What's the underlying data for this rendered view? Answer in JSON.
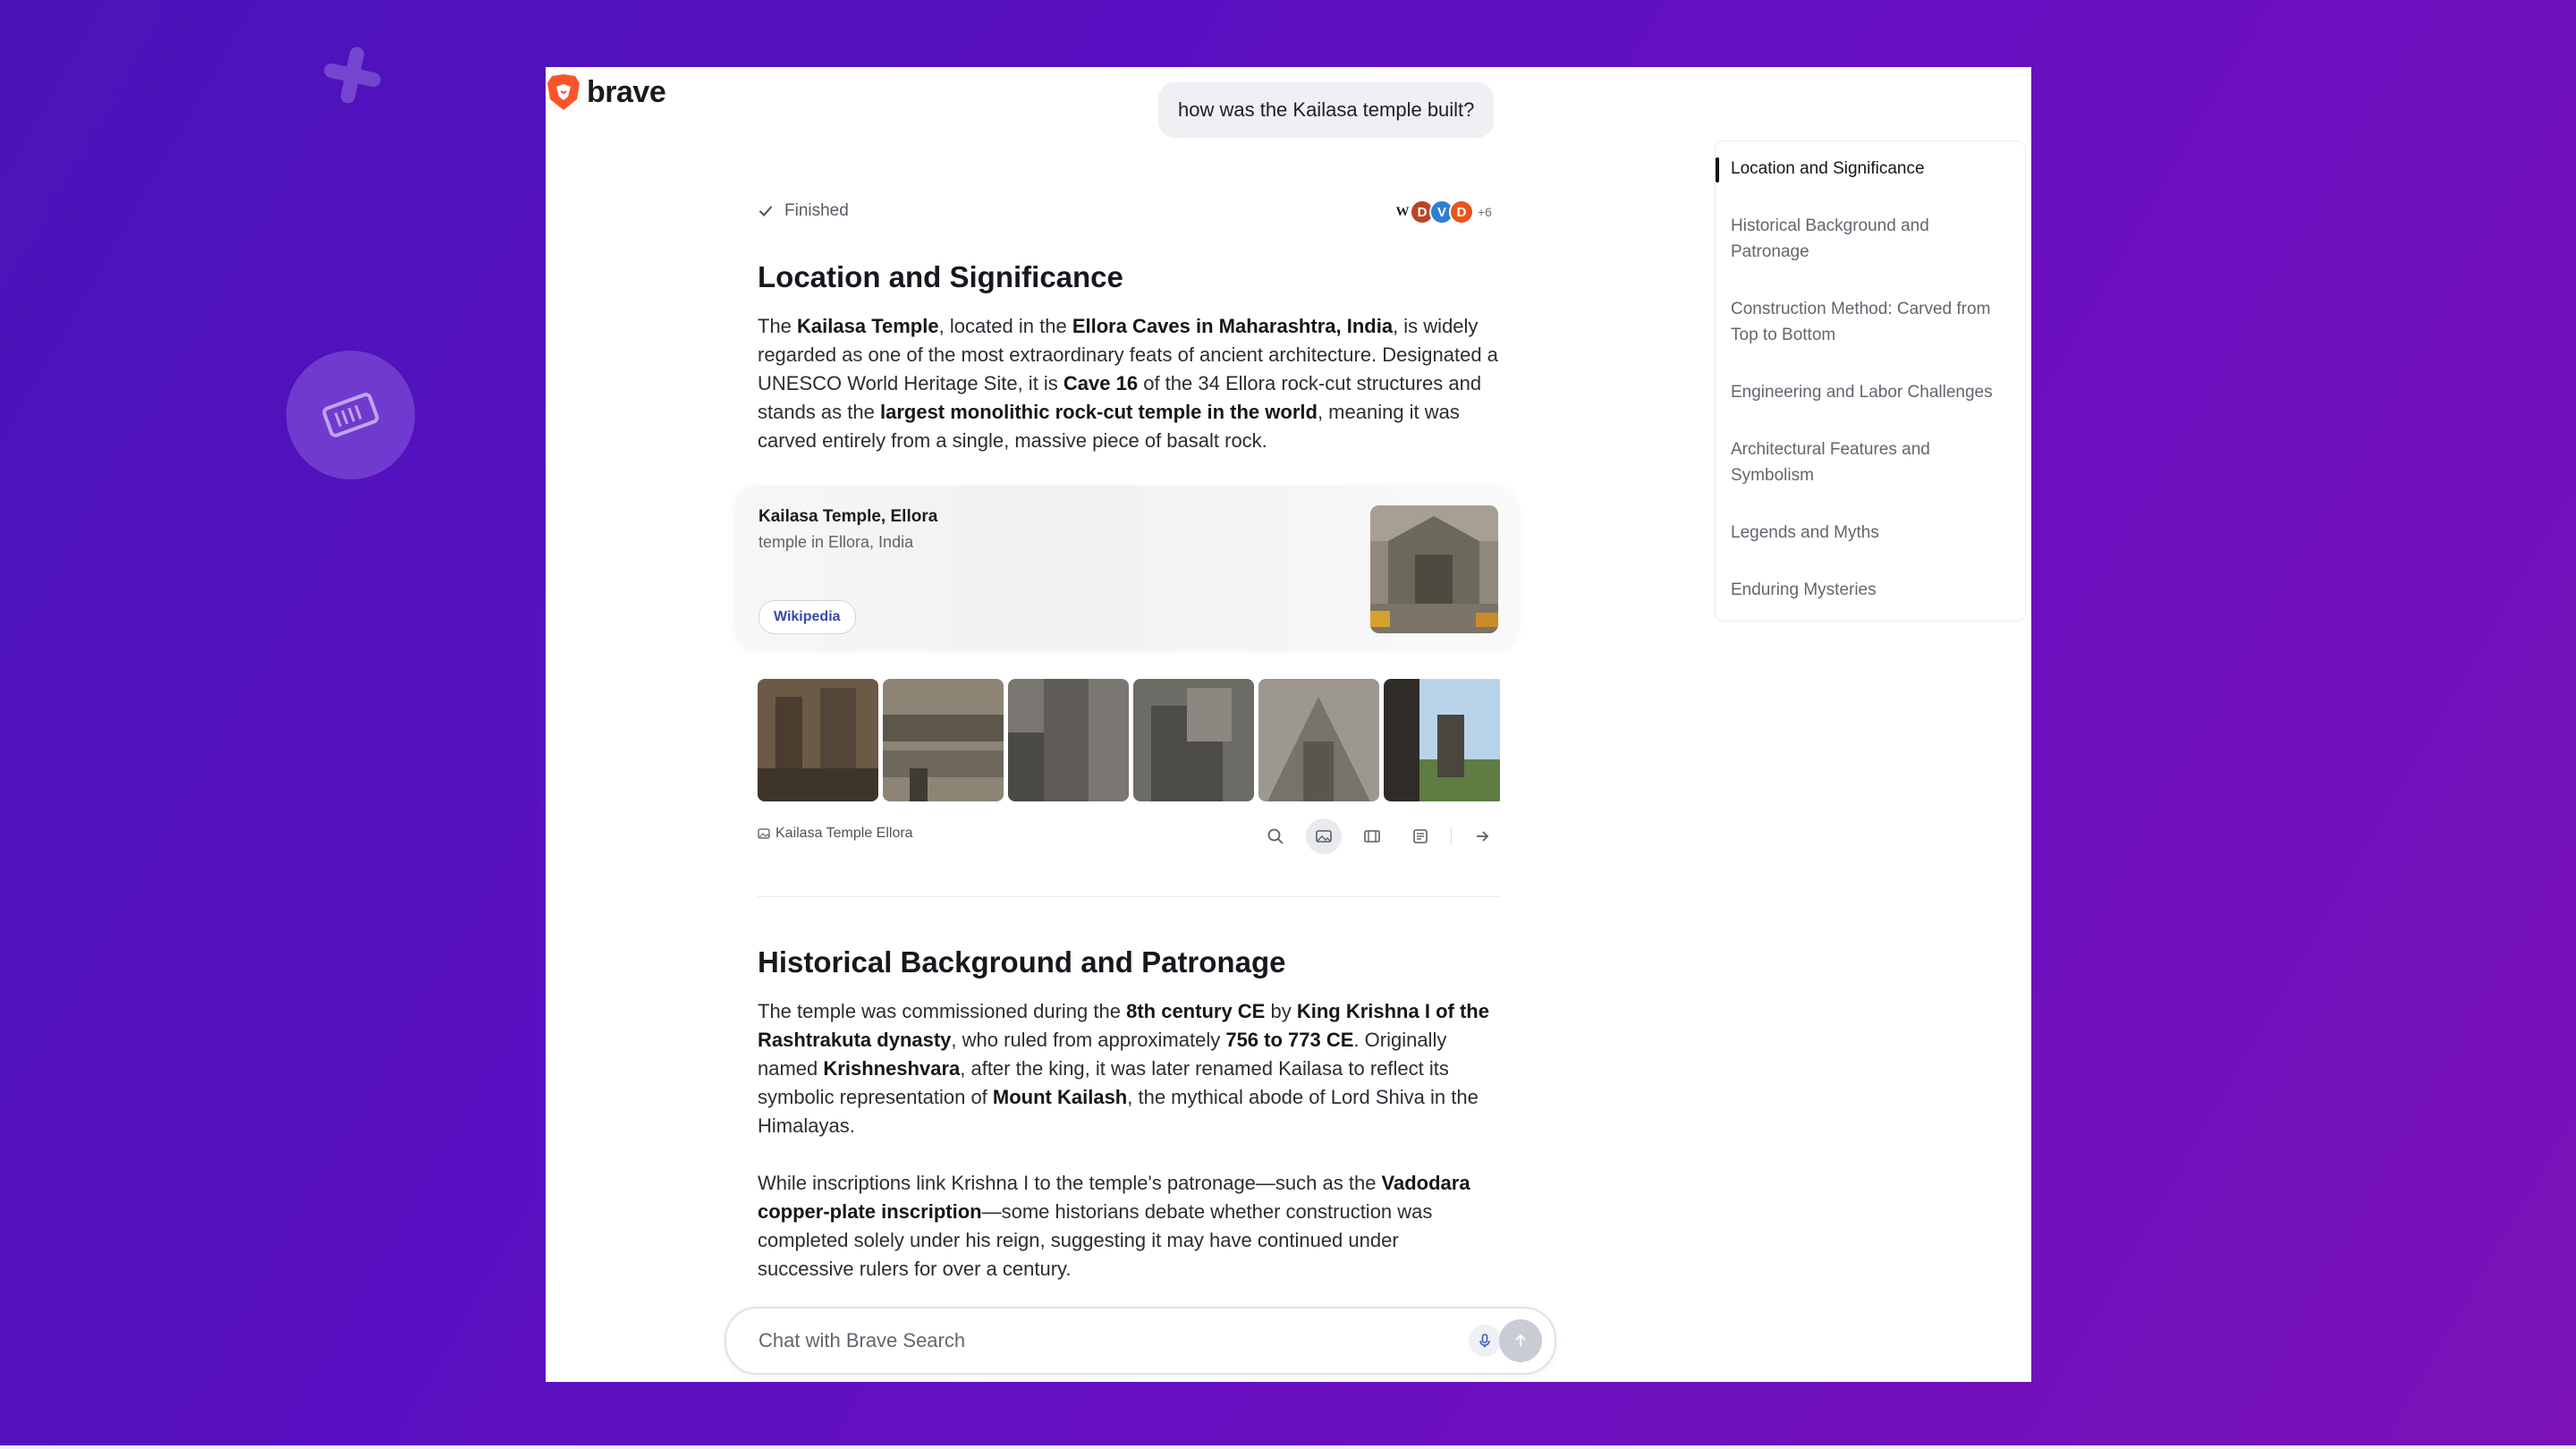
{
  "app": {
    "logo_text": "brave"
  },
  "query": "how was the Kailasa temple built?",
  "status": {
    "label": "Finished",
    "sources_more": "+6"
  },
  "sections": [
    {
      "title": "Location and Significance",
      "paragraph": "The **Kailasa Temple**, located in the **Ellora Caves in Maharashtra, India**, is widely regarded as one of the most extraordinary feats of ancient architecture. Designated a UNESCO World Heritage Site, it is **Cave 16** of the 34 Ellora rock-cut structures and stands as the **largest monolithic rock-cut temple in the world**, meaning it was carved entirely from a single, massive piece of basalt rock."
    },
    {
      "title": "Historical Background and Patronage",
      "paragraph1": "The temple was commissioned during the **8th century CE** by **King Krishna I of the Rashtrakuta dynasty**, who ruled from approximately **756 to 773 CE**. Originally named **Krishneshvara**, after the king, it was later renamed Kailasa to reflect its symbolic representation of **Mount Kailash**, the mythical abode of Lord Shiva in the Himalayas.",
      "paragraph2": "While inscriptions link Krishna I to the temple's patronage—such as the **Vadodara copper-plate inscription**—some historians debate whether construction was completed solely under his reign, suggesting it may have continued under successive rulers for over a century."
    }
  ],
  "knowledge_card": {
    "title": "Kailasa Temple, Ellora",
    "subtitle": "temple in Ellora, India",
    "button": "Wikipedia"
  },
  "image_strip": {
    "label": "Kailasa Temple Ellora"
  },
  "chat": {
    "placeholder": "Chat with Brave Search"
  },
  "toc": [
    {
      "label": "Location and Significance",
      "active": true
    },
    {
      "label": "Historical Background and Patronage",
      "active": false
    },
    {
      "label": "Construction Method: Carved from Top to Bottom",
      "active": false
    },
    {
      "label": "Engineering and Labor Challenges",
      "active": false
    },
    {
      "label": "Architectural Features and Symbolism",
      "active": false
    },
    {
      "label": "Legends and Myths",
      "active": false
    },
    {
      "label": "Enduring Mysteries",
      "active": false
    }
  ],
  "colors": {
    "background": "#5a10c2",
    "brand": "#fb542b",
    "link": "#3949a8"
  }
}
